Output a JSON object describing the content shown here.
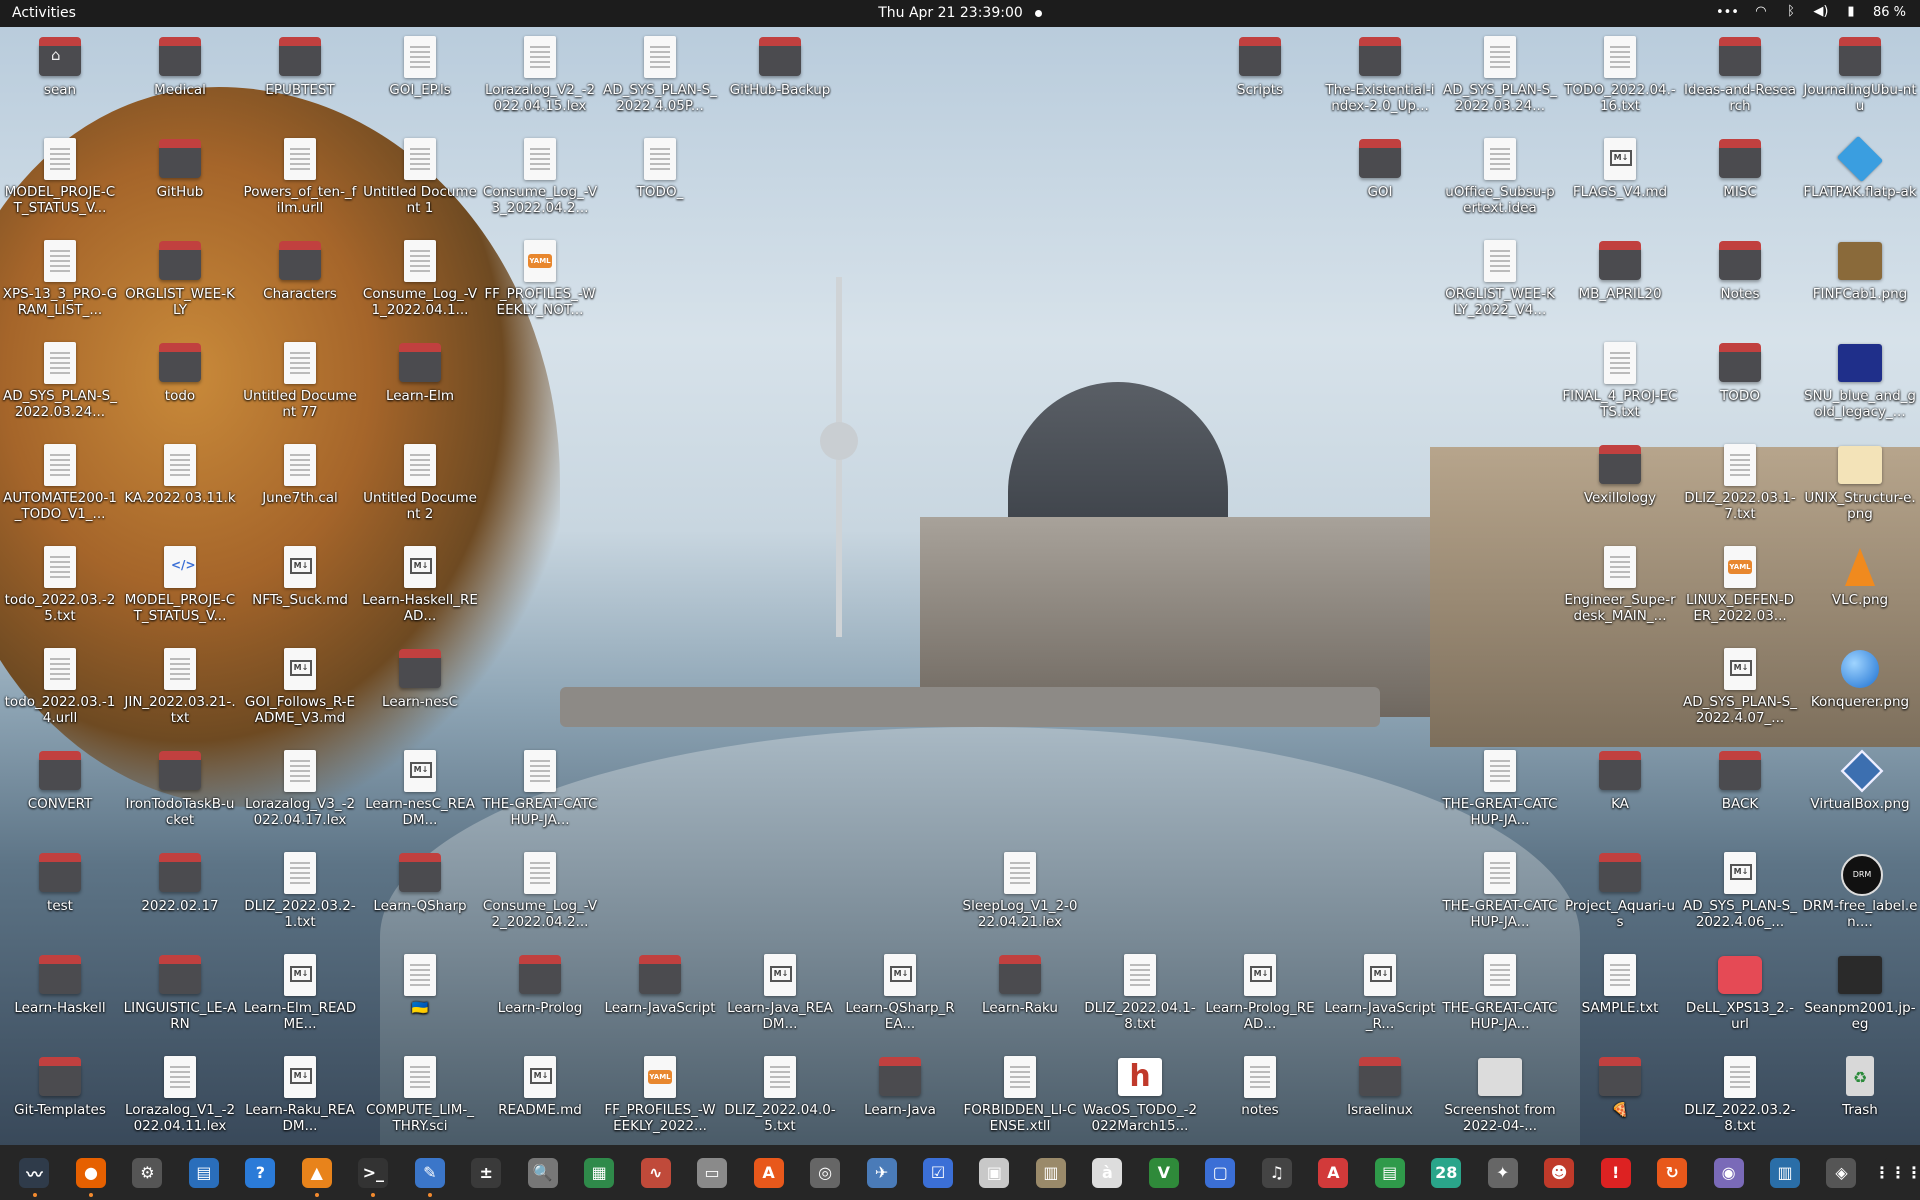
{
  "topbar": {
    "activities": "Activities",
    "clock": "Thu Apr 21  23:39:00",
    "tray_more": "•••",
    "battery": "86 %"
  },
  "colors": {
    "folder_tab": "#c1403f",
    "folder_body": "#4b4b4f",
    "topbar": "#1c1c1c",
    "dock": "#262626",
    "running_dot": "#f28a2e"
  },
  "desktop_icons": [
    {
      "label": "sean",
      "type": "home"
    },
    {
      "label": "Medical",
      "type": "folder"
    },
    {
      "label": "EPUBTEST",
      "type": "folder"
    },
    {
      "label": "GOI_EP.ls",
      "type": "file"
    },
    {
      "label": "Lorazalog_V2_-2022.04.15.lex",
      "type": "file"
    },
    {
      "label": "AD_SYS_PLAN-S_2022.4.05P...",
      "type": "file"
    },
    {
      "label": "GitHub-Backup",
      "type": "folder"
    },
    {
      "label": "Scripts",
      "type": "folder"
    },
    {
      "label": "The-Existential-index-2.0_Up...",
      "type": "folder"
    },
    {
      "label": "AD_SYS_PLAN-S_2022.03.24...",
      "type": "file"
    },
    {
      "label": "TODO_2022.04.-16.txt",
      "type": "file"
    },
    {
      "label": "Ideas-and-Research",
      "type": "folder"
    },
    {
      "label": "JournalingUbu-ntu",
      "type": "folder"
    },
    {
      "label": "MODEL_PROJE-CT_STATUS_V...",
      "type": "file"
    },
    {
      "label": "GitHub",
      "type": "folder"
    },
    {
      "label": "Powers_of_ten-_film.urll",
      "type": "file"
    },
    {
      "label": "Untitled Document 1",
      "type": "file"
    },
    {
      "label": "Consume_Log_-V3_2022.04.2...",
      "type": "file"
    },
    {
      "label": "TODO_",
      "type": "file"
    },
    {
      "label": "GOI",
      "type": "folder"
    },
    {
      "label": "uOffice_Subsu-pertext.idea",
      "type": "file"
    },
    {
      "label": "FLAGS_V4.md",
      "type": "md"
    },
    {
      "label": "MISC",
      "type": "folder"
    },
    {
      "label": "FLATPAK.flatp-ak",
      "type": "flatpak"
    },
    {
      "label": "XPS-13_3_PRO-GRAM_LIST_...",
      "type": "file"
    },
    {
      "label": "ORGLIST_WEE-KLY",
      "type": "folder"
    },
    {
      "label": "Characters",
      "type": "folder"
    },
    {
      "label": "Consume_Log_-V1_2022.04.1...",
      "type": "file"
    },
    {
      "label": "FF_PROFILES_-WEEKLY_NOT...",
      "type": "yaml"
    },
    {
      "label": "ORGLIST_WEE-KLY_2022_V4...",
      "type": "file"
    },
    {
      "label": "MB_APRIL20",
      "type": "folder"
    },
    {
      "label": "Notes",
      "type": "folder"
    },
    {
      "label": "FINFCab1.png",
      "type": "image",
      "color": "#8a6a3a"
    },
    {
      "label": "AD_SYS_PLAN-S_2022.03.24...",
      "type": "file"
    },
    {
      "label": "todo",
      "type": "folder"
    },
    {
      "label": "Untitled Document 77",
      "type": "file"
    },
    {
      "label": "Learn-Elm",
      "type": "folder"
    },
    {
      "label": "FINAL_4_PROJ-ECTS.txt",
      "type": "file"
    },
    {
      "label": "TODO",
      "type": "folder"
    },
    {
      "label": "SNU_blue_and_gold_legacy_...",
      "type": "image",
      "color": "#1f2f8a"
    },
    {
      "label": "AUTOMATE200-1_TODO_V1_...",
      "type": "file"
    },
    {
      "label": "KA.2022.03.11.k",
      "type": "file"
    },
    {
      "label": "June7th.cal",
      "type": "file"
    },
    {
      "label": "Untitled Document 2",
      "type": "file"
    },
    {
      "label": "Vexillology",
      "type": "folder"
    },
    {
      "label": "DLIZ_2022.03.1-7.txt",
      "type": "file"
    },
    {
      "label": "UNIX_Structur-e.png",
      "type": "image",
      "color": "#f3e3b8"
    },
    {
      "label": "todo_2022.03.-25.txt",
      "type": "file"
    },
    {
      "label": "MODEL_PROJE-CT_STATUS_V...",
      "type": "code"
    },
    {
      "label": "NFTs_Suck.md",
      "type": "md"
    },
    {
      "label": "Learn-Haskell_READ...",
      "type": "md"
    },
    {
      "label": "Engineer_Supe-rdesk_MAIN_...",
      "type": "file"
    },
    {
      "label": "LINUX_DEFEN-DER_2022.03...",
      "type": "yaml"
    },
    {
      "label": "VLC.png",
      "type": "vlc"
    },
    {
      "label": "todo_2022.03.-14.urll",
      "type": "file"
    },
    {
      "label": "JIN_2022.03.21-.txt",
      "type": "file"
    },
    {
      "label": "GOI_Follows_R-EADME_V3.md",
      "type": "md"
    },
    {
      "label": "Learn-nesC",
      "type": "folder"
    },
    {
      "label": "AD_SYS_PLAN-S_2022.4.07_...",
      "type": "md"
    },
    {
      "label": "Konquerer.png",
      "type": "globe"
    },
    {
      "label": "CONVERT",
      "type": "folder"
    },
    {
      "label": "IronTodoTaskB-ucket",
      "type": "folder"
    },
    {
      "label": "Lorazalog_V3_-2022.04.17.lex",
      "type": "file"
    },
    {
      "label": "Learn-nesC_READM...",
      "type": "md"
    },
    {
      "label": "THE-GREAT-CATCHUP-JA...",
      "type": "file"
    },
    {
      "label": "THE-GREAT-CATCHUP-JA...",
      "type": "file"
    },
    {
      "label": "KA",
      "type": "folder"
    },
    {
      "label": "BACK",
      "type": "folder"
    },
    {
      "label": "VirtualBox.png",
      "type": "vbox"
    },
    {
      "label": "test",
      "type": "folder"
    },
    {
      "label": "2022.02.17",
      "type": "folder"
    },
    {
      "label": "DLIZ_2022.03.2-1.txt",
      "type": "file"
    },
    {
      "label": "Learn-QSharp",
      "type": "folder"
    },
    {
      "label": "Consume_Log_-V2_2022.04.2...",
      "type": "file"
    },
    {
      "label": "SleepLog_V1_2-022.04.21.lex",
      "type": "file"
    },
    {
      "label": "THE-GREAT-CATCHUP-JA...",
      "type": "file"
    },
    {
      "label": "Project_Aquari-us",
      "type": "folder"
    },
    {
      "label": "AD_SYS_PLAN-S_2022.4.06_...",
      "type": "md"
    },
    {
      "label": "DRM-free_label.en....",
      "type": "drm"
    },
    {
      "label": "Learn-Haskell",
      "type": "folder"
    },
    {
      "label": "LINGUISTIC_LE-ARN",
      "type": "folder"
    },
    {
      "label": "Learn-Elm_README...",
      "type": "md"
    },
    {
      "label": "🇺🇦",
      "type": "file"
    },
    {
      "label": "Learn-Prolog",
      "type": "folder"
    },
    {
      "label": "Learn-JavaScript",
      "type": "folder"
    },
    {
      "label": "Learn-Java_READM...",
      "type": "md"
    },
    {
      "label": "Learn-QSharp_REA...",
      "type": "md"
    },
    {
      "label": "Learn-Raku",
      "type": "folder"
    },
    {
      "label": "DLIZ_2022.04.1-8.txt",
      "type": "file"
    },
    {
      "label": "Learn-Prolog_READ...",
      "type": "md"
    },
    {
      "label": "Learn-JavaScript_R...",
      "type": "md"
    },
    {
      "label": "THE-GREAT-CATCHUP-JA...",
      "type": "file"
    },
    {
      "label": "SAMPLE.txt",
      "type": "file"
    },
    {
      "label": "DeLL_XPS13_2.-url",
      "type": "nosign"
    },
    {
      "label": "Seanpm2001.jp-eg",
      "type": "image",
      "color": "#2a2a2a"
    },
    {
      "label": "Git-Templates",
      "type": "folder"
    },
    {
      "label": "Lorazalog_V1_-2022.04.11.lex",
      "type": "file"
    },
    {
      "label": "Learn-Raku_READM...",
      "type": "md"
    },
    {
      "label": "COMPUTE_LIM-_THRY.sci",
      "type": "file"
    },
    {
      "label": "README.md",
      "type": "md"
    },
    {
      "label": "FF_PROFILES_-WEEKLY_2022...",
      "type": "yaml"
    },
    {
      "label": "DLIZ_2022.04.0-5.txt",
      "type": "file"
    },
    {
      "label": "Learn-Java",
      "type": "folder"
    },
    {
      "label": "FORBIDDEN_LI-CENSE.xtll",
      "type": "file"
    },
    {
      "label": "WacOS_TODO_-2022March15...",
      "type": "hbox"
    },
    {
      "label": "notes",
      "type": "file"
    },
    {
      "label": "Israelinux",
      "type": "folder"
    },
    {
      "label": "Screenshot from 2022-04-...",
      "type": "image",
      "color": "#dcdcdc"
    },
    {
      "label": "🍕",
      "type": "folder"
    },
    {
      "label": "DLIZ_2022.03.2-8.txt",
      "type": "file"
    },
    {
      "label": "Trash",
      "type": "trash"
    }
  ],
  "dock": [
    {
      "name": "system-monitor",
      "glyph": "〰",
      "color": "#2f3b4a"
    },
    {
      "name": "firefox",
      "glyph": "●",
      "color": "#e66000"
    },
    {
      "name": "settings",
      "glyph": "⚙",
      "color": "#555"
    },
    {
      "name": "libreoffice-writer",
      "glyph": "▤",
      "color": "#2a6ebb"
    },
    {
      "name": "help",
      "glyph": "?",
      "color": "#2b7bd8"
    },
    {
      "name": "vlc",
      "glyph": "▲",
      "color": "#e8831b"
    },
    {
      "name": "terminal",
      "glyph": ">_",
      "color": "#333"
    },
    {
      "name": "text-editor",
      "glyph": "✎",
      "color": "#3b76c9"
    },
    {
      "name": "calculator",
      "glyph": "±",
      "color": "#3a3a3a"
    },
    {
      "name": "image-viewer",
      "glyph": "🔍",
      "color": "#777"
    },
    {
      "name": "calc",
      "glyph": "▦",
      "color": "#2f8a4a"
    },
    {
      "name": "system-monitor-2",
      "glyph": "∿",
      "color": "#c04a3a"
    },
    {
      "name": "files",
      "glyph": "▭",
      "color": "#8a8a8a"
    },
    {
      "name": "software",
      "glyph": "A",
      "color": "#e8581b"
    },
    {
      "name": "disks",
      "glyph": "◎",
      "color": "#666"
    },
    {
      "name": "shotwell",
      "glyph": "✈",
      "color": "#4a7bb8"
    },
    {
      "name": "tasks",
      "glyph": "☑",
      "color": "#3b6fd6"
    },
    {
      "name": "document-scanner",
      "glyph": "▣",
      "color": "#c8c8c8"
    },
    {
      "name": "archive-manager",
      "glyph": "▥",
      "color": "#9a8a6a"
    },
    {
      "name": "character-map",
      "glyph": "à",
      "color": "#ddd"
    },
    {
      "name": "vim",
      "glyph": "V",
      "color": "#2f8a3a"
    },
    {
      "name": "screen-share",
      "glyph": "▢",
      "color": "#3b6fd6"
    },
    {
      "name": "music",
      "glyph": "♫",
      "color": "#444"
    },
    {
      "name": "document-viewer",
      "glyph": "A",
      "color": "#d23a3a"
    },
    {
      "name": "spreadsheet",
      "glyph": "▤",
      "color": "#2f9a4a"
    },
    {
      "name": "calendar",
      "glyph": "28",
      "color": "#2aa58a"
    },
    {
      "name": "wine",
      "glyph": "✦",
      "color": "#666"
    },
    {
      "name": "game",
      "glyph": "☻",
      "color": "#c03a2a"
    },
    {
      "name": "alert",
      "glyph": "!",
      "color": "#d22"
    },
    {
      "name": "updater",
      "glyph": "↻",
      "color": "#e8581b"
    },
    {
      "name": "screenshot",
      "glyph": "◉",
      "color": "#7a6ab8"
    },
    {
      "name": "remote",
      "glyph": "▥",
      "color": "#2a6ea8"
    },
    {
      "name": "inkscape",
      "glyph": "◈",
      "color": "#555"
    },
    {
      "name": "show-apps",
      "glyph": "⋮⋮⋮",
      "color": "#262626"
    }
  ]
}
